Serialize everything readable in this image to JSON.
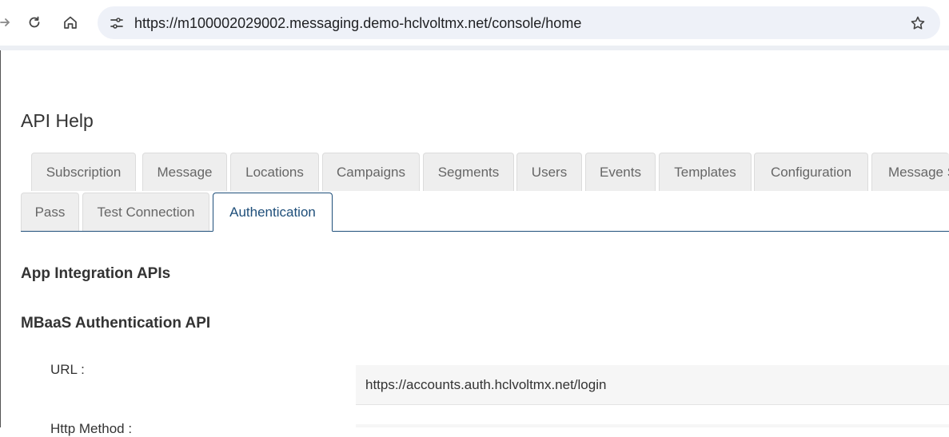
{
  "browser": {
    "url": "https://m100002029002.messaging.demo-hclvoltmx.net/console/home"
  },
  "page": {
    "title": "API Help"
  },
  "tabs_row1": [
    {
      "label": "Subscription"
    },
    {
      "label": "Message"
    },
    {
      "label": "Locations"
    },
    {
      "label": "Campaigns"
    },
    {
      "label": "Segments"
    },
    {
      "label": "Users"
    },
    {
      "label": "Events"
    },
    {
      "label": "Templates"
    },
    {
      "label": "Configuration"
    },
    {
      "label": "Message S"
    }
  ],
  "tabs_row2": [
    {
      "label": "Pass"
    },
    {
      "label": "Test Connection"
    },
    {
      "label": "Authentication",
      "active": true
    }
  ],
  "content": {
    "section_heading": "App Integration APIs",
    "api_heading": "MBaaS Authentication API",
    "url_label": "URL :",
    "url_value": "https://accounts.auth.hclvoltmx.net/login",
    "http_method_label": "Http Method :"
  },
  "colors": {
    "accent": "#1f4f7a",
    "tab_bg": "#eeeeee",
    "omnibox_bg": "#eef1f8"
  },
  "icons": [
    "forward-icon",
    "reload-icon",
    "home-icon",
    "site-info-icon",
    "bookmark-star-icon"
  ]
}
